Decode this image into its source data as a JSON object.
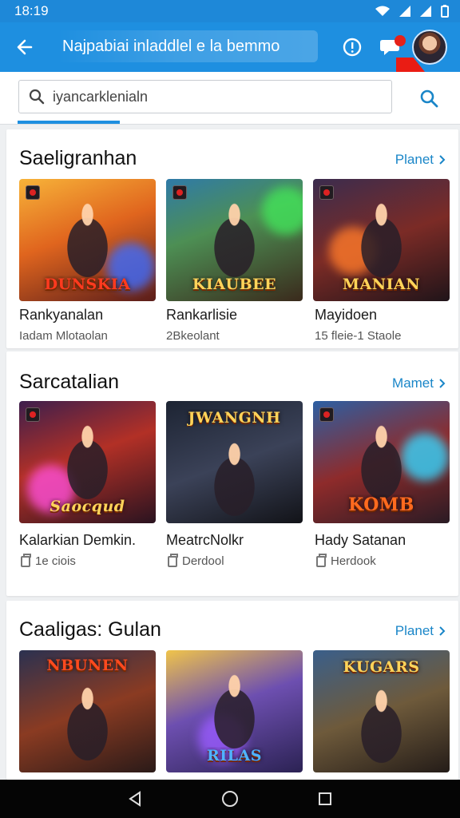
{
  "status": {
    "time": "18:19"
  },
  "header": {
    "title": "Najpabiai inladdlel e la bemmo",
    "icons": [
      "back-arrow-icon",
      "info-icon",
      "chat-icon",
      "avatar"
    ]
  },
  "search": {
    "value": "iyancarklenialn"
  },
  "sections": [
    {
      "title": "Saeligranhan",
      "see_all": "Planet",
      "games": [
        {
          "name": "Rankyanalan",
          "sub": "Iadam Mlotaolan",
          "logo": "DUNSKIA"
        },
        {
          "name": "Rankarlisie",
          "sub": "2Bkeolant",
          "logo": "KIAUBEE"
        },
        {
          "name": "Mayidoen",
          "sub": "15 fleie-1 Staole",
          "logo": "MANIAN"
        }
      ]
    },
    {
      "title": "Sarcatalian",
      "see_all": "Mamet",
      "games": [
        {
          "name": "Kalarkian Demkin.",
          "sub": "1e ciois",
          "logo": "Saocqud"
        },
        {
          "name": "MeatrcNolkr",
          "sub": "Derdool",
          "logo": "JWANGNH"
        },
        {
          "name": "Hady Satanan",
          "sub": "Herdook",
          "logo": "KOMB"
        }
      ]
    },
    {
      "title": "Caaligas: Gulan",
      "see_all": "Planet",
      "games": [
        {
          "logo": "NBUNEN"
        },
        {
          "logo": "RILAS"
        },
        {
          "logo": "KUGARS"
        }
      ]
    }
  ],
  "colors": {
    "appbar": "#1e8fe0",
    "accent": "#1a86c8",
    "badge": "#e5211a"
  }
}
